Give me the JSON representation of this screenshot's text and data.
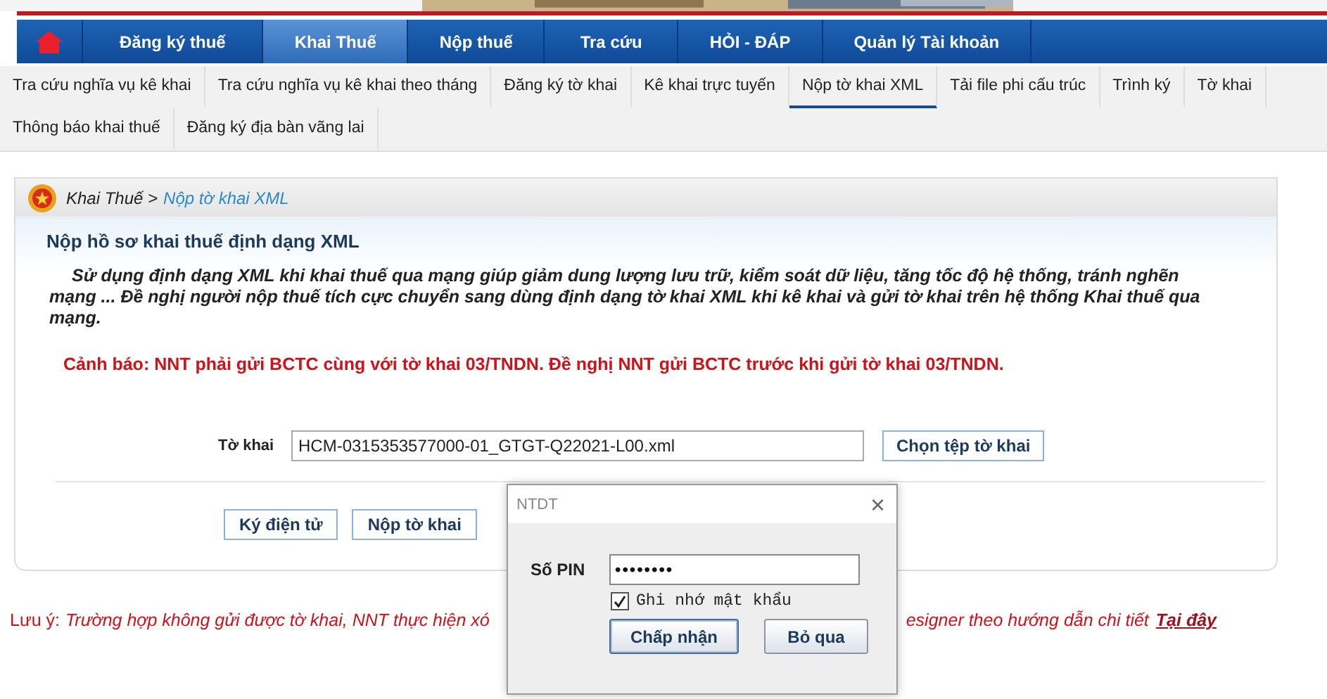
{
  "nav": {
    "items": [
      {
        "label": "Đăng ký thuế",
        "selected": false
      },
      {
        "label": "Khai Thuế",
        "selected": true
      },
      {
        "label": "Nộp thuế",
        "selected": false
      },
      {
        "label": "Tra cứu",
        "selected": false
      },
      {
        "label": "HỎI - ĐÁP",
        "selected": false
      },
      {
        "label": "Quản lý Tài khoản",
        "selected": false
      }
    ]
  },
  "subnav": {
    "items": [
      {
        "label": "Tra cứu nghĩa vụ kê khai",
        "selected": false
      },
      {
        "label": "Tra cứu nghĩa vụ kê khai theo tháng",
        "selected": false
      },
      {
        "label": "Đăng ký tờ khai",
        "selected": false
      },
      {
        "label": "Kê khai trực tuyến",
        "selected": false
      },
      {
        "label": "Nộp tờ khai XML",
        "selected": true
      },
      {
        "label": "Tải file phi cấu trúc",
        "selected": false
      },
      {
        "label": "Trình ký",
        "selected": false
      },
      {
        "label": "Tờ khai",
        "selected": false
      },
      {
        "label": "Thông báo khai thuế",
        "selected": false
      },
      {
        "label": "Đăng ký địa bàn vãng lai",
        "selected": false
      }
    ]
  },
  "breadcrumb": {
    "parent": "Khai Thuế >",
    "current": "Nộp tờ khai XML"
  },
  "section_title": "Nộp hồ sơ khai thuế định dạng XML",
  "intro": "Sử dụng định dạng XML khi khai thuế qua mạng giúp giảm dung lượng lưu trữ, kiểm soát dữ liệu, tăng tốc độ hệ thống, tránh nghẽn mạng ... Đề nghị người nộp thuế tích cực chuyển sang dùng định dạng tờ khai XML khi kê khai và gửi tờ khai trên hệ thống Khai thuế qua mạng.",
  "warning": "Cảnh báo: NNT phải gửi BCTC cùng với tờ khai 03/TNDN. Đề nghị NNT gửi BCTC trước khi gửi tờ khai 03/TNDN.",
  "file_field": {
    "label": "Tờ khai",
    "value": "HCM-0315353577000-01_GTGT-Q22021-L00.xml",
    "button": "Chọn tệp tờ khai"
  },
  "actions": [
    "Ký điện tử",
    "Nộp tờ khai"
  ],
  "note": {
    "prefix": "Lưu ý:",
    "text_left": "Trường hợp không gửi được tờ khai, NNT thực hiện xó",
    "text_right": "esigner theo hướng dẫn chi tiết",
    "link": "Tại đây"
  },
  "dialog": {
    "title": "NTDT",
    "close": "×",
    "pin_label": "Số PIN",
    "pin_value": "••••••••",
    "remember": {
      "label": "Ghi nhớ mật khẩu",
      "checked": true
    },
    "buttons": [
      {
        "label": "Chấp nhận",
        "selected": true
      },
      {
        "label": "Bỏ qua",
        "selected": false
      }
    ]
  }
}
